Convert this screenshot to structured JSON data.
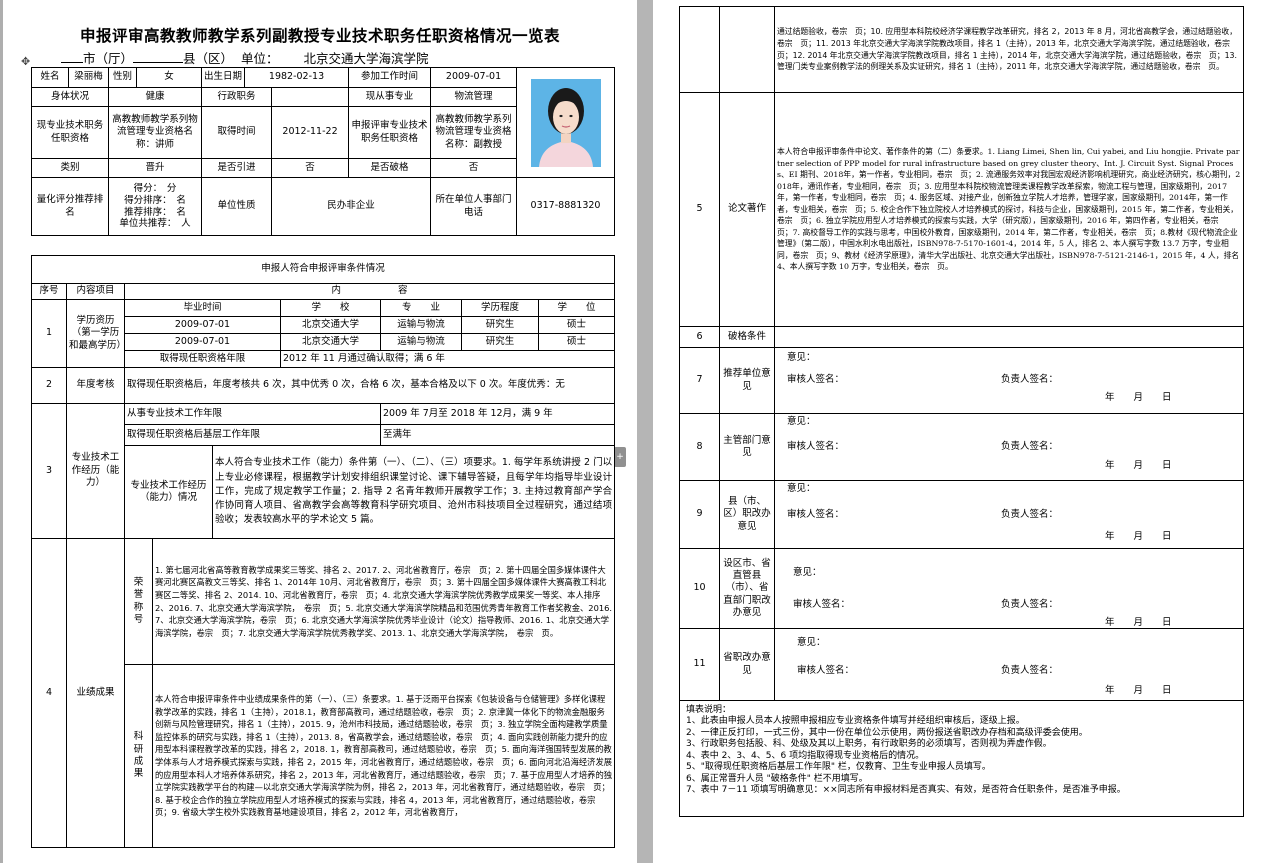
{
  "title": "申报评审高教教师教学系列副教授专业技术职务任职资格情况一览表",
  "header": {
    "city_blank": "",
    "city_label": "市（厅）",
    "county_blank": "",
    "county_label": "县（区）",
    "unit_label": "单位：",
    "unit_value": "北京交通大学海滨学院"
  },
  "icons": {
    "move_icon": "✥",
    "handle_icon": "+"
  },
  "basic": {
    "name_label": "姓名",
    "name": "梁丽梅",
    "gender_label": "性别",
    "gender": "女",
    "dob_label": "出生日期",
    "dob": "1982-02-13",
    "work_start_label": "参加工作时间",
    "work_start": "2009-07-01",
    "health_label": "身体状况",
    "health": "健康",
    "admin_label": "行政职务",
    "admin": "",
    "specialty_label": "现从事专业",
    "specialty": "物流管理",
    "current_qual_label": "现专业技术职务任职资格",
    "current_qual": "高教教师教学系列物流管理专业资格名称：讲师",
    "obtain_time_label": "取得时间",
    "obtain_time": "2012-11-22",
    "applying_label": "申报评审专业技术职务任职资格",
    "applying": "高教教师教学系列物流管理专业资格名称：副教授",
    "category_label": "类别",
    "category": "晋升",
    "transfer_label": "是否引进",
    "transfer": "否",
    "exception_label": "是否破格",
    "exception": "否",
    "score_label": "量化评分推荐排名",
    "score_lines": [
      "得分：　分",
      "得分排序：　名",
      "推荐排序：　名",
      "单位共推荐：　人"
    ],
    "unit_nature_label": "单位性质",
    "unit_nature": "民办非企业",
    "phone_label": "所在单位人事部门电话",
    "phone": "0317-8881320"
  },
  "conditions": {
    "section_title": "申报人符合申报评审条件情况",
    "seq_label": "序号",
    "item_label": "内容项目",
    "content_label": "内　　　　　　容",
    "row1": {
      "seq": "1",
      "label": "学历资历（第一学历和最高学历）",
      "headers": [
        "毕业时间",
        "学　　校",
        "专　　业",
        "学历程度",
        "学　　位"
      ],
      "rows": [
        [
          "2009-07-01",
          "北京交通大学",
          "运输与物流",
          "研究生",
          "硕士"
        ],
        [
          "2009-07-01",
          "北京交通大学",
          "运输与物流",
          "研究生",
          "硕士"
        ]
      ],
      "years_label": "取得现任职资格年限",
      "years_value": "2012 年 11 月通过确认取得；满 6 年"
    },
    "row2": {
      "seq": "2",
      "label": "年度考核",
      "text": "取得现任职资格后，年度考核共 6 次，其中优秀 0 次，合格 6 次，基本合格及以下 0 次。年度优秀：无"
    },
    "row3": {
      "seq": "3",
      "label": "专业技术工作经历（能力）",
      "a_label": "从事专业技术工作年限",
      "a_value": "2009 年 7月至 2018 年 12月，满 9 年",
      "b_label": "取得现任职资格后基层工作年限",
      "b_value": "至满年",
      "c_label": "专业技术工作经历（能力）情况",
      "c_value": "本人符合专业技术工作（能力）条件第（一）、（二）、（三）项要求。1. 每学年系统讲授 2 门以上专业必修课程，根据教学计划安排组织课堂讨论、课下辅导答疑，且每学年均指导毕业设计工作，完成了规定教学工作量；2. 指导 2 名青年教师开展教学工作；3. 主持过教育部产学合作协同育人项目、省高教学会高等教育科学研究项目、沧州市科技项目全过程研究，通过结项验收；发表较高水平的学术论文 5 篇。"
    },
    "row4": {
      "seq": "4",
      "label": "业绩成果",
      "honor_label": "荣誉称号",
      "honor_text": "1. 第七届河北省高等教育教学成果奖三等奖、排名 2、2017. 2、河北省教育厅，卷宗　页；2. 第十四届全国多媒体课件大赛河北赛区高教文三等奖、排名 1、2014年 10月、河北省教育厅，卷宗　页；3. 第十四届全国多媒体课件大赛高教工科北赛区二等奖、排名 2、2014. 10、河北省教育厅，卷宗　页；4. 北京交通大学海滨学院优秀教学成果奖一等奖、本人排序 2、2016. 7、北京交通大学海滨学院，　卷宗　页；5. 北京交通大学海滨学院精品和范围优秀青年教育工作者奖教金、2016. 7、北京交通大学海滨学院，卷宗　页；6. 北京交通大学海滨学院优秀毕业设计（论文）指导教师、2016. 1、北京交通大学海滨学院，卷宗　页；7. 北京交通大学海滨学院优秀教学奖、2013. 1、北京交通大学海滨学院，　卷宗　页。",
      "research_label": "科研成果",
      "research_text": "本人符合申报评审条件中业绩成果条件的第（一）、（三）条要求。1. 基于泛雨平台探索《包装设备与仓储管理》多样化课程教学改革的实践，排名 1（主持），2018.1，教育部高教司，通过结题验收，卷宗　页；2. 京津冀一体化下的物流金融服务创新与风险管理研究，排名 1（主持），2015. 9，沧州市科技局，通过结题验收，卷宗　页；3. 独立学院全面构建教学质量监控体系的研究与实践，排名 1（主持），2013. 8，省高教学会，通过结题验收，卷宗　页；4. 面向实践创新能力提升的应用型本科课程教学改革的实践，排名 2，2018. 1，教育部高教司，通过结题验收，卷宗　页；5. 面向海洋强国转型发展的教学体系与人才培养模式探索与实践，排名 2，2015 年，河北省教育厅，通过结题验收，卷宗　页；6. 面向河北沿海经济发展的应用型本科人才培养体系研究，排名 2，2013 年，河北省教育厅，通过结题验收，卷宗　页；7. 基于应用型人才培养的独立学院实践教学平台的构建—以北京交通大学海滨学院为例，排名 2，2013 年，河北省教育厅，通过结题验收，卷宗　页；8. 基于校企合作的独立学院应用型人才培养模式的探索与实践，排名 4，2013 年，河北省教育厅，通过结题验收，卷宗　页；9. 省级大学生校外实践教育基地建设项目，排名 2，2012 年，河北省教育厅，",
      "continued_text": "通过结题验收，卷宗　页；10. 应用型本科院校经济学课程教学改革研究，排名 2，2013 年 8 月，河北省高教学会，通过结题验收，卷宗　页；11. 2013 年北京交通大学海滨学院教改项目，排名 1（主持），2013 年，北京交通大学海滨学院，通过结题验收，卷宗　页；12. 2014 年北京交通大学海滨学院教改项目，排名 1 主持），2014 年，北京交通大学海滨学院，通过结题验收，卷宗　页；13. 管理门类专业案例教学法的例理关系及实证研究，排名 1（主持），2011 年，北京交通大学海滨学院，通过结题验收，卷宗　页。"
    },
    "row5": {
      "seq": "5",
      "label": "论文著作",
      "text": "本人符合申报评审条件中论文、著作条件的第（二）条要求。1. Liang Limei, Shen lin, Cui yabei, and Liu hongjie. Private partner selection of PPP model for rural infrastructure based on grey cluster theory、Int. J. Circuit Syst. Signal Process、EI 期刊、2018年，第一作者，专业相同，卷宗　页；2. 流通服务效率对我国宏观经济影响机理研究，商业经济研究，核心期刊，2018年，通讯作者，专业相同，卷宗　页；3. 应用型本科院校物流管理类课程教学改革探索，物流工程与管理，国家级期刊，2017 年，第一作者，专业相同，卷宗　页；4. 服务区域、对接产业，创新独立学院人才培养，管理学家，国家级期刊，2014年，第一作者，专业相关，卷宗　页；5. 校企合作下独立院校人才培养模式的探讨，科技与企业，国家级期刊，2015 年，第二作者，专业相关，卷宗　页；6. 独立学院应用型人才培养模式的探索与实践，大学（研究版），国家级期刊，2016 年，第四作者，专业相关，卷宗　页；7. 高校督导工作的实践与思考，中国校外教育，国家级期刊，2014 年，第二作者，专业相关，卷宗　页；8.教材《现代物流企业管理》（第二版），中国水利水电出版社，ISBN978-7-5170-1601-4，2014 年，5 人，排名 2、本人撰写字数 13.7 万字，专业相同，卷宗　页；9、教材《经济学原理》，清华大学出版社、北京交通大学出版社，ISBN978-7-5121-2146-1，2015 年，4 人，排名 4、本人撰写字数 10 万字，专业相关，卷宗　页。"
    },
    "row6": {
      "seq": "6",
      "label": "破格条件",
      "text": ""
    },
    "opinion_rows": [
      {
        "seq": "7",
        "label": "推荐单位意见",
        "opinion": "意见：",
        "reviewer": "审核人签名：",
        "leader": "负责人签名：",
        "date": "年　　月　　日"
      },
      {
        "seq": "8",
        "label": "主管部门意见",
        "opinion": "意见：",
        "reviewer": "审核人签名：",
        "leader": "负责人签名：",
        "date": "年　　月　　日"
      },
      {
        "seq": "9",
        "label": "县（市、区）职改办意见",
        "opinion": "意见：",
        "reviewer": "审核人签名：",
        "leader": "负责人签名：",
        "date": "年　　月　　日"
      },
      {
        "seq": "10",
        "label": "设区市、省直管县（市）、省直部门职改办意见",
        "opinion": "意见：",
        "reviewer": "审核人签名：",
        "leader": "负责人签名：",
        "date": "年　　月　　日"
      },
      {
        "seq": "11",
        "label": "省职改办意见",
        "opinion": "意见：",
        "reviewer": "审核人签名：",
        "leader": "负责人签名：",
        "date": "年　　月　　日"
      }
    ]
  },
  "notes": {
    "title": "填表说明：",
    "items": [
      "1、此表由申报人员本人按照申报相应专业资格条件填写并经组织审核后，逐级上报。",
      "2、一律正反打印，一式三份，其中一份在单位公示使用，两份报送省职改办存档和高级评委会使用。",
      "3、行政职务包括股、科、处级及其以上职务，有行政职务的必须填写，否则视为弄虚作假。",
      "4、表中 2、3、4、5、6 项均指取得现专业资格后的情况。",
      "5、\"取得现任职资格后基层工作年限\" 栏，仅教育、卫生专业申报人员填写。",
      "6、属正常晋升人员 \"破格条件\" 栏不用填写。",
      "7、表中 7－11 项填写明确意见：××同志所有申报材料是否真实、有效，是否符合任职条件，是否准予申报。"
    ]
  }
}
